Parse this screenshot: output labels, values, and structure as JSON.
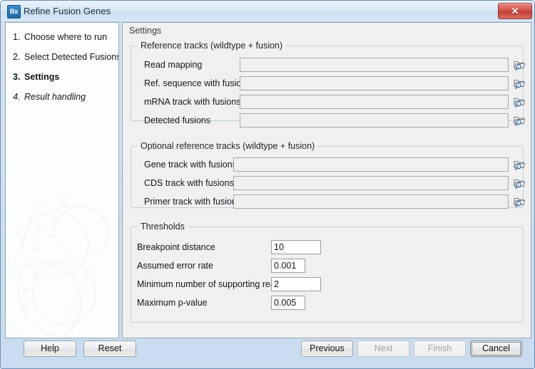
{
  "window": {
    "title": "Refine Fusion Genes",
    "app_icon_label": "Bx",
    "close_label": "✕"
  },
  "sidebar": {
    "items": [
      {
        "num": "1.",
        "label": "Choose where to run",
        "state": "done"
      },
      {
        "num": "2.",
        "label": "Select Detected Fusions",
        "state": "done"
      },
      {
        "num": "3.",
        "label": "Settings",
        "state": "current"
      },
      {
        "num": "4.",
        "label": "Result handling",
        "state": "future"
      }
    ]
  },
  "main": {
    "header": "Settings",
    "groups": [
      {
        "title": "Reference tracks (wildtype + fusion)",
        "fields": [
          {
            "label": "Read mapping",
            "value": "",
            "enabled": false,
            "browse": true
          },
          {
            "label": "Ref. sequence with fusions",
            "value": "",
            "enabled": false,
            "browse": true
          },
          {
            "label": "mRNA track with fusions",
            "value": "",
            "enabled": false,
            "browse": true
          },
          {
            "label": "Detected fusions",
            "value": "",
            "enabled": false,
            "browse": true
          }
        ]
      },
      {
        "title": "Optional reference tracks (wildtype + fusion)",
        "fields": [
          {
            "label": "Gene track with fusions",
            "value": "",
            "enabled": false,
            "browse": true
          },
          {
            "label": "CDS track with fusions",
            "value": "",
            "enabled": false,
            "browse": true
          },
          {
            "label": "Primer track with fusions",
            "value": "",
            "enabled": false,
            "browse": true
          }
        ]
      },
      {
        "title": "Thresholds",
        "fields": [
          {
            "label": "Breakpoint distance",
            "value": "10",
            "enabled": true,
            "browse": false
          },
          {
            "label": "Assumed error rate",
            "value": "0.001",
            "enabled": true,
            "browse": false
          },
          {
            "label": "Minimum number of supporting reads",
            "value": "2",
            "enabled": true,
            "browse": false
          },
          {
            "label": "Maximum p-value",
            "value": "0.005",
            "enabled": true,
            "browse": false
          }
        ]
      }
    ]
  },
  "buttons": {
    "help": "Help",
    "reset": "Reset",
    "previous": "Previous",
    "next": "Next",
    "finish": "Finish",
    "cancel": "Cancel"
  },
  "colors": {
    "titlebar_start": "#e9f2fb",
    "titlebar_end": "#d7e7f7",
    "close_red": "#c33c33",
    "panel_bg": "#f0f0f0",
    "group_border": "#c2cfdd",
    "accent_icon": "#1f6aa8"
  }
}
